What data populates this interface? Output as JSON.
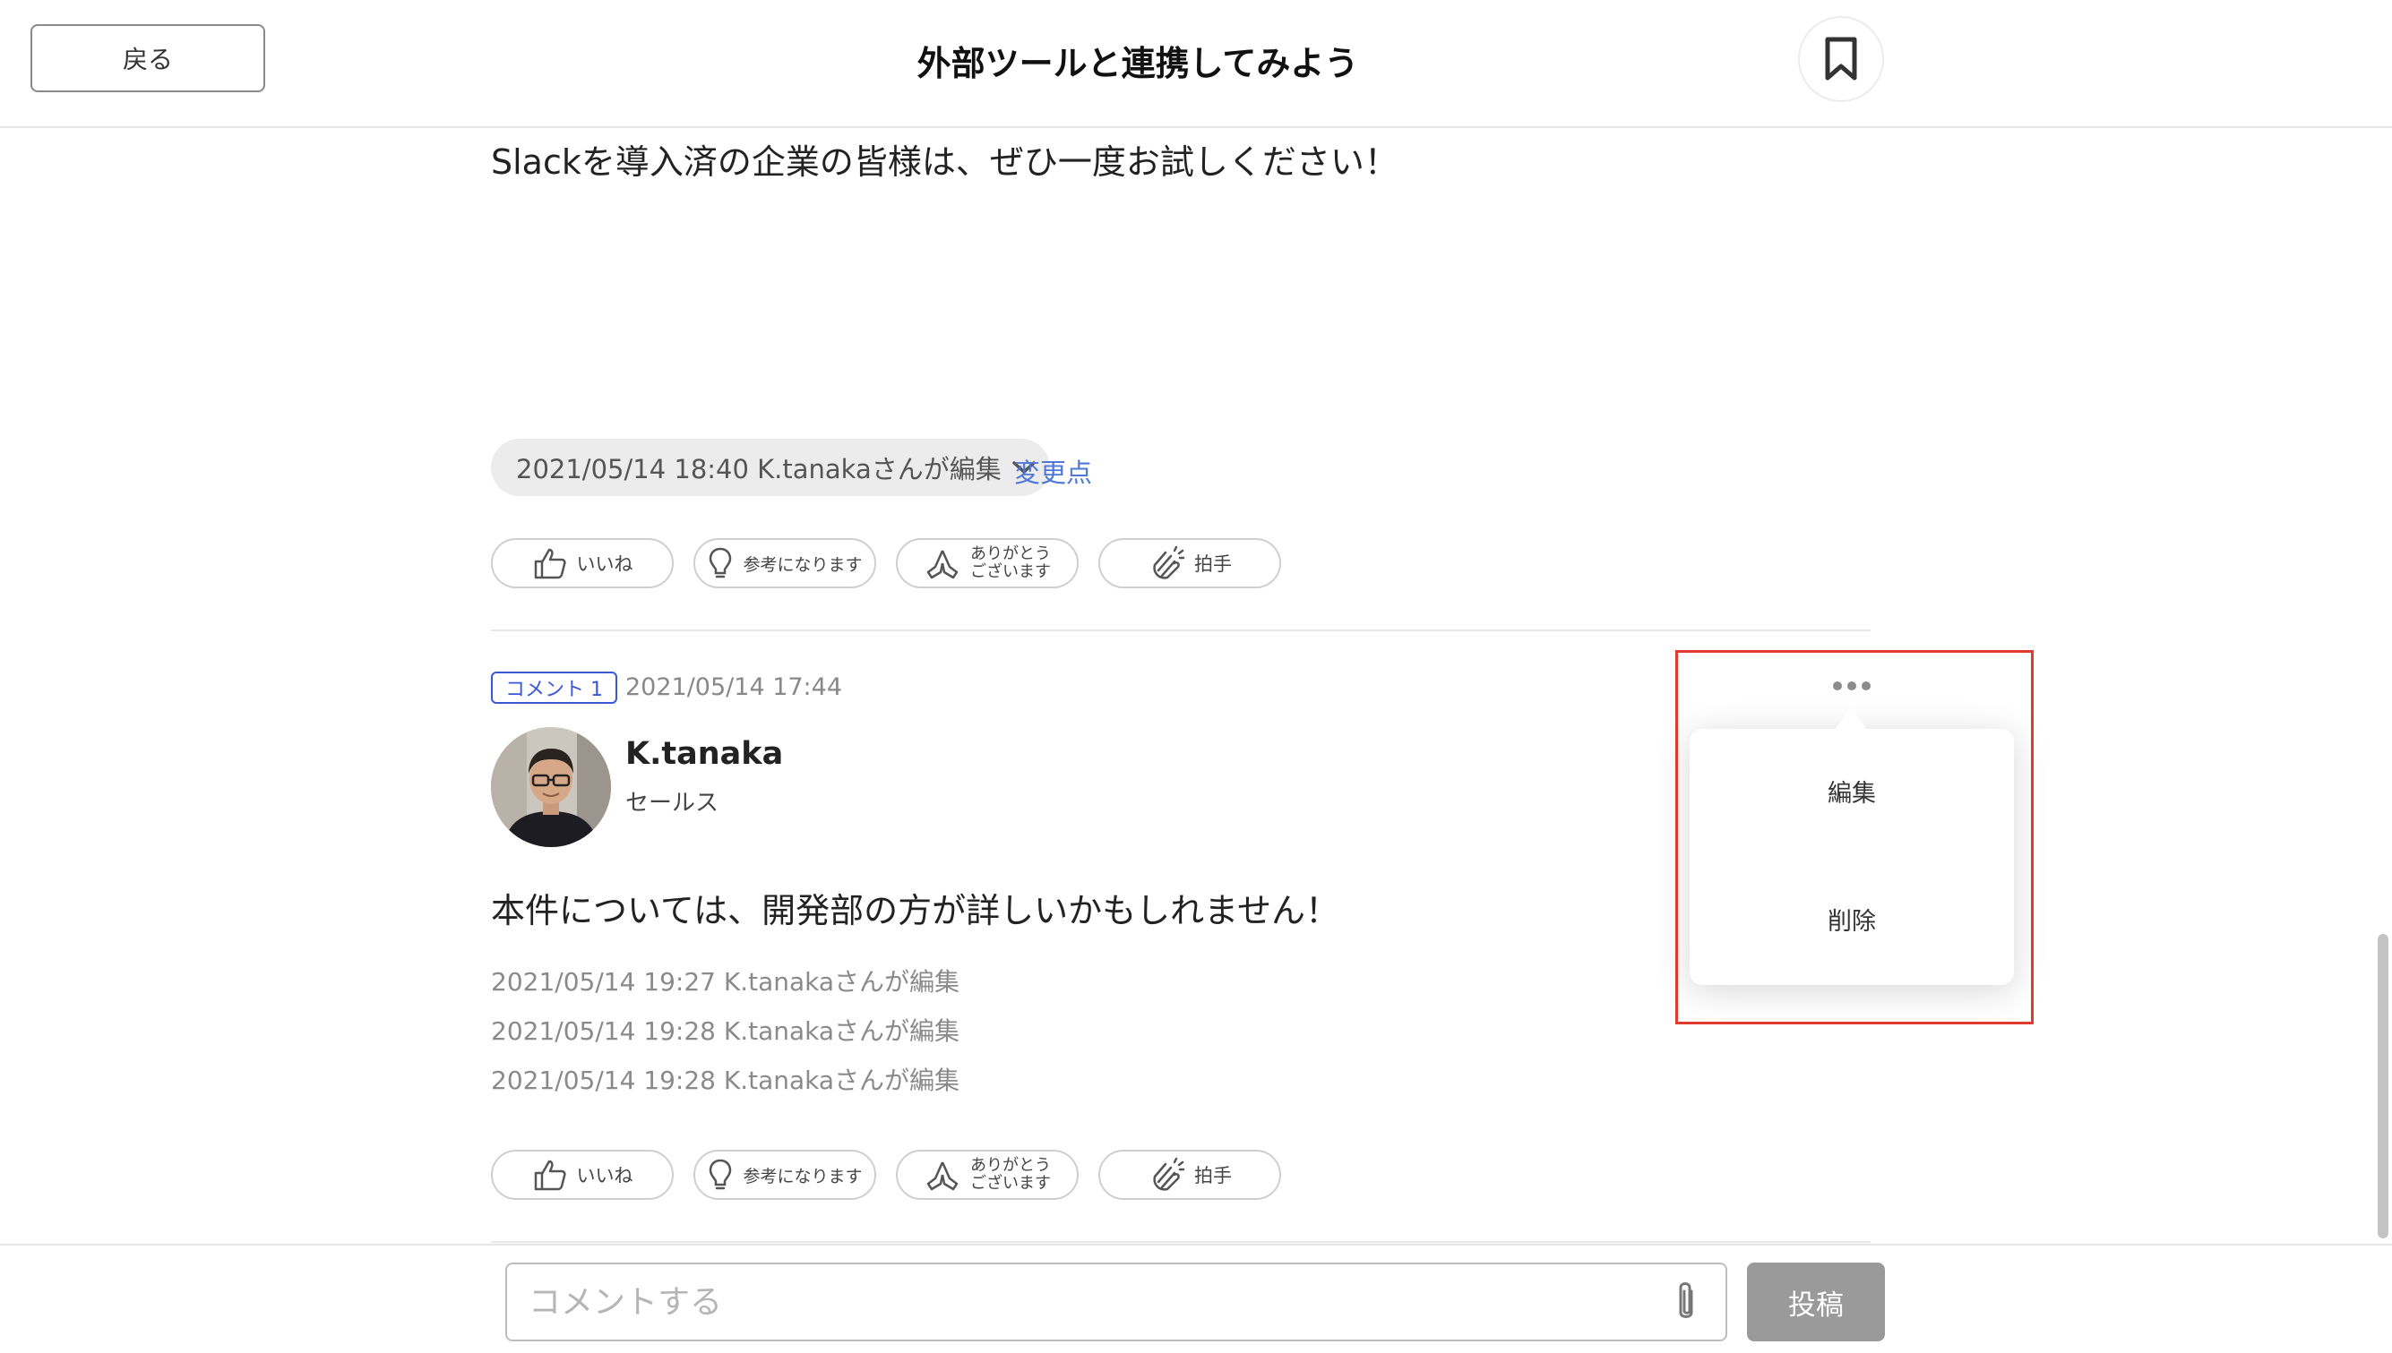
{
  "header": {
    "back_label": "戻る",
    "title": "外部ツールと連携してみよう",
    "bookmark_icon": "bookmark-icon"
  },
  "post": {
    "text": "Slackを導入済の企業の皆様は、ぜひ一度お試しください！",
    "edit_history_label": "2021/05/14 18:40 K.tanakaさんが編集",
    "changes_link": "変更点"
  },
  "reactions": [
    {
      "icon": "thumbs-up-icon",
      "label": "いいね"
    },
    {
      "icon": "lightbulb-icon",
      "label": "参考になります"
    },
    {
      "icon": "praying-hands-icon",
      "label_line1": "ありがとう",
      "label_line2": "ございます"
    },
    {
      "icon": "clapping-hands-icon",
      "label": "拍手"
    }
  ],
  "comment": {
    "badge": "コメント 1",
    "timestamp": "2021/05/14 17:44",
    "author_name": "K.tanaka",
    "author_role": "セールス",
    "text": "本件については、開発部の方が詳しいかもしれません！",
    "edit_log": [
      "2021/05/14 19:27 K.tanakaさんが編集",
      "2021/05/14 19:28 K.tanakaさんが編集",
      "2021/05/14 19:28 K.tanakaさんが編集"
    ]
  },
  "context_menu": {
    "items": [
      "編集",
      "削除"
    ],
    "highlight_color": "#e0392d"
  },
  "footer": {
    "input_placeholder": "コメントする",
    "input_value": "",
    "submit_label": "投稿"
  },
  "colors": {
    "accent_blue": "#3a58d4",
    "link_blue": "#4f77d8",
    "submit_gray": "#9a9a9a"
  }
}
